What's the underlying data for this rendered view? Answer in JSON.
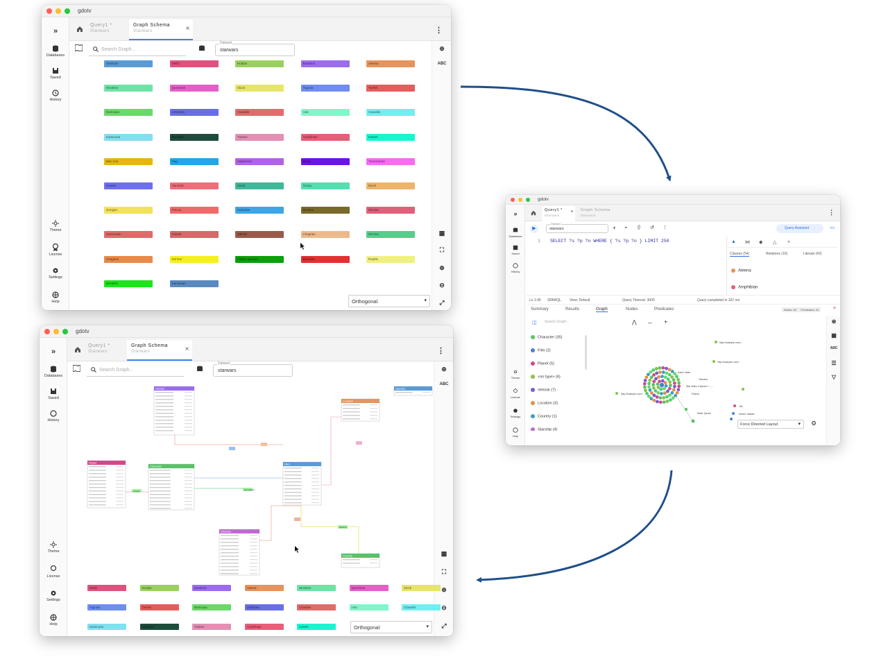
{
  "app_title": "gdotv",
  "sidebar": {
    "databases": "Databases",
    "saved": "Saved",
    "history": "History",
    "theme": "Theme",
    "license": "License",
    "settings": "Settings",
    "help": "Help"
  },
  "tabs": {
    "query_tab": "Query1 *",
    "query_sub": "Starwars",
    "schema_tab": "Graph Schema",
    "schema_sub": "Starwars"
  },
  "toolbar": {
    "search_placeholder": "Search Graph...",
    "dataset_label": "Dataset",
    "dataset_value": "starwars"
  },
  "layout": {
    "orthogonal": "Orthogonal",
    "force": "Force Directed Layout"
  },
  "chips": [
    {
      "label": "Skakoan",
      "color": "#5b9bd5"
    },
    {
      "label": "Nelloi",
      "color": "#e0527e"
    },
    {
      "label": "Rodian",
      "color": "#9bd060"
    },
    {
      "label": "Bantiemi",
      "color": "#9b6cf0"
    },
    {
      "label": "Aleena",
      "color": "#e6935c"
    },
    {
      "label": "Wookiee",
      "color": "#6ee3a5"
    },
    {
      "label": "Quermian",
      "color": "#e460c8"
    },
    {
      "label": "Sluck",
      "color": "#e7e56a"
    },
    {
      "label": "Togruta",
      "color": "#6f8df2"
    },
    {
      "label": "Twi'lek",
      "color": "#e65c5c"
    },
    {
      "label": "Neimoian",
      "color": "#6ad86a"
    },
    {
      "label": "Umbaran",
      "color": "#6a6ee6"
    },
    {
      "label": "Clawdite",
      "color": "#e26b6b"
    },
    {
      "label": "Hutt",
      "color": "#7ff7c9"
    },
    {
      "label": "Clawdite",
      "color": "#6ef0f0"
    },
    {
      "label": "Kaminoan",
      "color": "#84dff0"
    },
    {
      "label": "Reptilian",
      "color": "#1e4d3c"
    },
    {
      "label": "Tusken",
      "color": "#e48fb4"
    },
    {
      "label": "Amphibian",
      "color": "#e55f78"
    },
    {
      "label": "Kalesh",
      "color": "#19f5d0"
    },
    {
      "label": "Mon Cal",
      "color": "#e8b613"
    },
    {
      "label": "Dug",
      "color": "#23a8e6"
    },
    {
      "label": "Vulptereen",
      "color": "#b163e6"
    },
    {
      "label": "Muun",
      "color": "#6b14e6"
    },
    {
      "label": "Trandoshan",
      "color": "#f06ef0"
    },
    {
      "label": "Human",
      "color": "#6e6ef0"
    },
    {
      "label": "Nautolan",
      "color": "#f06e7a"
    },
    {
      "label": "Xexto",
      "color": "#3fb89a"
    },
    {
      "label": "Toong",
      "color": "#52e0b0"
    },
    {
      "label": "Ewok",
      "color": "#eeb46a"
    },
    {
      "label": "Gungan",
      "color": "#f2e25a"
    },
    {
      "label": "Pau'an",
      "color": "#f06a6a"
    },
    {
      "label": "Sullustan",
      "color": "#3ea6e6"
    },
    {
      "label": "Mirialan",
      "color": "#7a6a2a"
    },
    {
      "label": "Ithorian",
      "color": "#e0607a"
    },
    {
      "label": "Geonosian",
      "color": "#e06a6a"
    },
    {
      "label": "Zabrak",
      "color": "#d46a6a"
    },
    {
      "label": "Zabrak",
      "color": "#9a5a4a"
    },
    {
      "label": "Chagrian",
      "color": "#eeb98a"
    },
    {
      "label": "Kel Dor",
      "color": "#5acb8a"
    },
    {
      "label": "Chagrian",
      "color": "#e88a4a"
    },
    {
      "label": "Kel Dor",
      "color": "#f6f01a"
    },
    {
      "label": "Yoda's species",
      "color": "#0aa00a"
    },
    {
      "label": "Besalisk",
      "color": "#e43030"
    },
    {
      "label": "Reptile",
      "color": "#f0f080"
    },
    {
      "label": "Besalisk",
      "color": "#1ae61a"
    },
    {
      "label": "Kaminoan",
      "color": "#5a8ac0"
    }
  ],
  "query": {
    "run": "SELECT ?s ?p ?o WHERE { ?s ?p ?o } LIMIT 250",
    "line_no": "1",
    "assistant": "Query Assistant",
    "status_pos": "Ln 1:45",
    "lang": "SPARQL",
    "view": "View: Default",
    "timeout": "Query Timeout: 3000",
    "completed": "Query completed in 321 ms"
  },
  "side_tabs": {
    "classes": "Classes (54)",
    "relations": "Relations (10)",
    "literals": "Literals (42)",
    "c1": "Aleena",
    "c2": "Amphibian"
  },
  "result_tabs": [
    "Summary",
    "Results",
    "Graph",
    "Nodes",
    "Predicates"
  ],
  "result_badges": {
    "nodes": "Nodes: 84",
    "predicates": "Predicates: 40"
  },
  "legend": [
    {
      "label": "Character (35)",
      "color": "#5cc06a"
    },
    {
      "label": "Film (2)",
      "color": "#4a7fd0"
    },
    {
      "label": "Planet (5)",
      "color": "#d04a8a"
    },
    {
      "label": "<no type> (6)",
      "color": "#8ac04a"
    },
    {
      "label": "Vehicle (7)",
      "color": "#7a5ad0"
    },
    {
      "label": "Location (3)",
      "color": "#e0904a"
    },
    {
      "label": "Country (1)",
      "color": "#3aa0c0"
    },
    {
      "label": "Starship (4)",
      "color": "#c06ad0"
    }
  ],
  "graph_labels": {
    "l1": "http://example.com/...",
    "l2": "http://example.com/...",
    "l3": "http://example.com/...",
    "n1": "Darth Vader",
    "n2": "Tatooine",
    "n3": "Star Wars: Episode I – ...",
    "n4": "Padmé",
    "n5": "Ratts Tyerell",
    "n6": "Obi",
    "n7": "Dexter Jettster"
  },
  "schema_tables": {
    "vehicle": "Vehicle",
    "planet": "Planet",
    "character": "Character",
    "film": "Film",
    "location": "Location",
    "starship": "Starship",
    "country": "Country",
    "species": "Species",
    "e1": "pilot",
    "e2": "homeworld",
    "e3": "vehicle",
    "e4": "starship"
  },
  "schema_chips": [
    {
      "label": "Nelloi",
      "color": "#e0527e"
    },
    {
      "label": "Rodian",
      "color": "#9bd060"
    },
    {
      "label": "Bantiemi",
      "color": "#9b6cf0"
    },
    {
      "label": "Aleena",
      "color": "#e6935c"
    },
    {
      "label": "Wookiee",
      "color": "#6ee3a5"
    },
    {
      "label": "Quermian",
      "color": "#e460c8"
    },
    {
      "label": "Sluck",
      "color": "#e7e56a"
    },
    {
      "label": "Togruta",
      "color": "#6f8df2"
    },
    {
      "label": "Twi'lek",
      "color": "#e65c5c"
    },
    {
      "label": "Neimoian",
      "color": "#6ad86a"
    },
    {
      "label": "Umbaran",
      "color": "#6a6ee6"
    },
    {
      "label": "Clawdite",
      "color": "#e26b6b"
    },
    {
      "label": "Hutt",
      "color": "#7ff7c9"
    },
    {
      "label": "Clawdite",
      "color": "#6ef0f0"
    },
    {
      "label": "Kaminoan",
      "color": "#84dff0"
    },
    {
      "label": "Reptilian",
      "color": "#1e4d3c"
    },
    {
      "label": "Tusken",
      "color": "#e48fb4"
    },
    {
      "label": "Amphibian",
      "color": "#e55f78"
    },
    {
      "label": "Kalesh",
      "color": "#19f5d0"
    }
  ],
  "arrow_color": "#1f4f8a"
}
